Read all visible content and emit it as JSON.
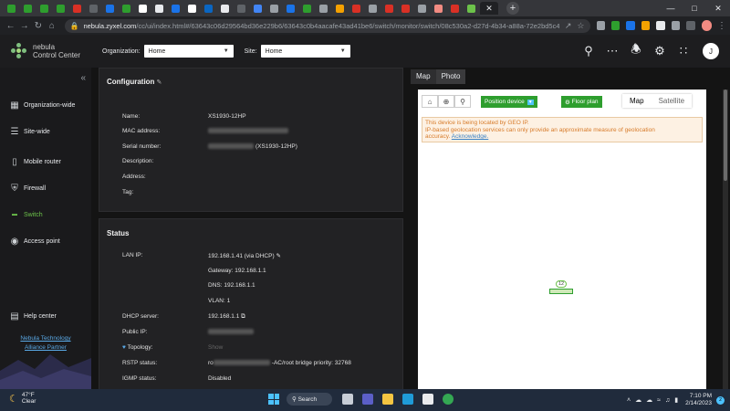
{
  "browser": {
    "url_host": "nebula.zyxel.com",
    "url_path": "/cc/ui/index.html#/63643c06d29564bd36e229b6/63643c0b4aacafe43ad41be6/switch/monitor/switch/08c530a2-d27d-4b34-a88a-72e2bd5c4...",
    "favicon_colors": [
      "#2e9e2e",
      "#2e9e2e",
      "#2e9e2e",
      "#2e9e2e",
      "#d93025",
      "#5f6368",
      "#1a73e8",
      "#2e9e2e",
      "#ffffff",
      "#e8eaed",
      "#1a73e8",
      "#ffffff",
      "#0a66c2",
      "#e8eaed",
      "#5f6368",
      "#4285f4",
      "#9aa0a6",
      "#1a73e8",
      "#2e9e2e",
      "#9aa0a6",
      "#f4a100",
      "#d93025",
      "#9aa0a6",
      "#d93025",
      "#d93025",
      "#9aa0a6",
      "#f28b82",
      "#d93025",
      "#6cc24a"
    ]
  },
  "header": {
    "logo_line1": "nebula",
    "logo_line2": "Control Center",
    "org_label": "Organization:",
    "org_value": "Home",
    "site_label": "Site:",
    "site_value": "Home",
    "avatar_initial": "J"
  },
  "sidebar": {
    "items": [
      {
        "label": "Organization-wide",
        "icon": "building-icon"
      },
      {
        "label": "Site-wide",
        "icon": "list-icon"
      },
      {
        "label": "Mobile router",
        "icon": "phone-icon"
      },
      {
        "label": "Firewall",
        "icon": "shield-icon"
      },
      {
        "label": "Switch",
        "icon": "switch-icon",
        "active": true
      },
      {
        "label": "Access point",
        "icon": "wifi-icon"
      },
      {
        "label": "Help center",
        "icon": "help-icon"
      }
    ],
    "partner_line1": "Nebula Technology",
    "partner_line2": "Alliance Partner"
  },
  "configuration": {
    "title": "Configuration",
    "rows": [
      {
        "label": "Name:",
        "value": "XS1930-12HP"
      },
      {
        "label": "MAC address:",
        "value": ""
      },
      {
        "label": "Serial number:",
        "value": "(XS1930-12HP)"
      },
      {
        "label": "Description:",
        "value": ""
      },
      {
        "label": "Address:",
        "value": ""
      },
      {
        "label": "Tag:",
        "value": ""
      }
    ]
  },
  "status": {
    "title": "Status",
    "lan_ip_label": "LAN IP:",
    "lan_ip_value": "192.168.1.41 (via DHCP)",
    "gateway": "Gateway: 192.168.1.1",
    "dns": "DNS: 192.168.1.1",
    "vlan": "VLAN: 1",
    "dhcp_label": "DHCP server:",
    "dhcp_value": "192.168.1.1",
    "public_ip_label": "Public IP:",
    "topology_label": "Topology:",
    "topology_value": "Show",
    "rstp_label": "RSTP status:",
    "rstp_prefix": "ro",
    "rstp_suffix": "-AC/root bridge priority: 32768",
    "igmp_label": "IGMP status:",
    "igmp_value": "Disabled"
  },
  "map_panel": {
    "tabs": [
      "Map",
      "Photo"
    ],
    "position_device": "Position device",
    "floor_plan": "Floor plan",
    "map_type": [
      "Map",
      "Satellite"
    ],
    "warning_line1": "This device is being located by GEO IP.",
    "warning_line2": "IP-based geolocation services can only provide an approximate measure of geolocation",
    "warning_line3": "accuracy.",
    "warning_link": "Acknowledge.",
    "marker_label": "12"
  },
  "taskbar": {
    "temp": "47°F",
    "condition": "Clear",
    "search": "Search",
    "time": "7:10 PM",
    "date": "2/14/2023",
    "notifications": "2"
  },
  "colors": {
    "accent": "#6cc24a",
    "button_green": "#2e9e2e",
    "link_blue": "#5aa9e6",
    "warning_text": "#d77b2a"
  }
}
